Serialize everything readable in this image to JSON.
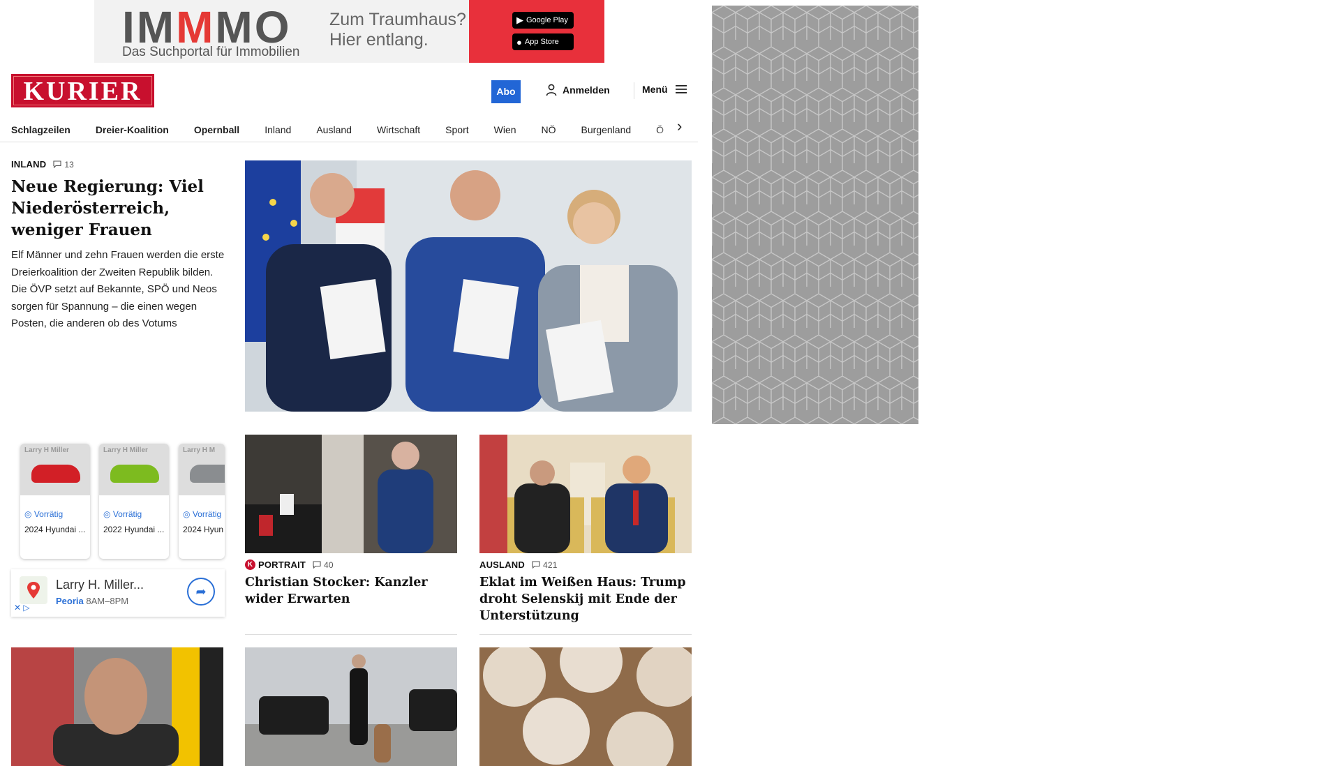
{
  "ad_banner": {
    "brand": "IMMMO",
    "brand_parts": [
      "IM",
      "M",
      "MO"
    ],
    "tagline": "Das Suchportal für Immobilien",
    "slogan": "Zum Traumhaus? Hier entlang.",
    "google_play": "Google Play",
    "app_store": "App Store"
  },
  "header": {
    "logo": "KURIER",
    "abo": "Abo",
    "login": "Anmelden",
    "menu": "Menü"
  },
  "nav": {
    "items": [
      "Schlagzeilen",
      "Dreier-Koalition",
      "Opernball",
      "Inland",
      "Ausland",
      "Wirtschaft",
      "Sport",
      "Wien",
      "NÖ",
      "Burgenland",
      "Ö"
    ]
  },
  "main_article": {
    "kicker": "INLAND",
    "comments": "13",
    "headline": "Neue Regierung: Viel Niederösterreich, weniger Frauen",
    "teaser": "Elf Männer und zehn Frauen werden die erste Dreierkoalition der Zweiten Republik bilden. Die ÖVP setzt auf Bekannte, SPÖ und Neos sorgen für Spannung – die einen wegen Posten, die anderen ob des Votums"
  },
  "car_ad": {
    "cards": [
      {
        "brand": "Larry H Miller",
        "stock": "Vorrätig",
        "model": "2024 Hyundai ...",
        "color": "#d21f26"
      },
      {
        "brand": "Larry H Miller",
        "stock": "Vorrätig",
        "model": "2022 Hyundai ...",
        "color": "#7dbb1f"
      },
      {
        "brand": "Larry H M",
        "stock": "Vorrätig",
        "model": "2024 Hyun",
        "color": "#8a8d90"
      }
    ],
    "location_name": "Larry H. Miller...",
    "location_city": "Peoria",
    "location_hours": "8AM–8PM"
  },
  "cards": [
    {
      "kicker": "PORTRAIT",
      "comments": "40",
      "headline": "Christian Stocker: Kanzler wider Erwarten",
      "badge": "K"
    },
    {
      "kicker": "AUSLAND",
      "comments": "421",
      "headline": "Eklat im Weißen Haus: Trump droht Selenskij mit Ende der Unterstützung"
    }
  ],
  "colors": {
    "brand_red": "#c8102e",
    "abo_blue": "#2266d6",
    "ad_red": "#e8303b"
  }
}
